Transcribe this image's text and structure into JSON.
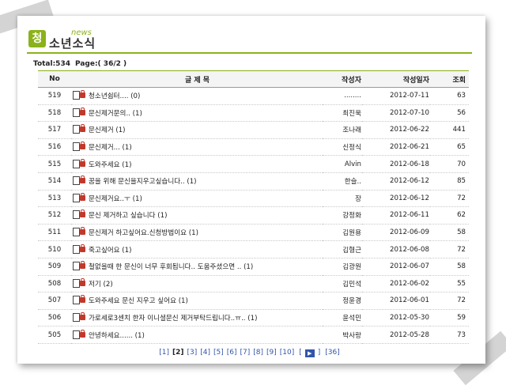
{
  "header": {
    "logo_char": "청",
    "logo_small": "news",
    "title": "소년소식"
  },
  "summary": {
    "total": "Total:534",
    "page": "Page:( 36/2 )"
  },
  "columns": {
    "no": "No",
    "title": "글 제 목",
    "author": "작성자",
    "date": "작성일자",
    "views": "조회"
  },
  "rows": [
    {
      "no": "519",
      "title": "청소년쉼터.... (0)",
      "author": "........",
      "date": "2012-07-11",
      "views": "63"
    },
    {
      "no": "518",
      "title": "문신제거문의.. (1)",
      "author": "최진욱",
      "date": "2012-07-10",
      "views": "56"
    },
    {
      "no": "517",
      "title": "문신제거 (1)",
      "author": "조나래",
      "date": "2012-06-22",
      "views": "441"
    },
    {
      "no": "516",
      "title": "문신제거... (1)",
      "author": "신정식",
      "date": "2012-06-21",
      "views": "65"
    },
    {
      "no": "515",
      "title": "도와주세요 (1)",
      "author": "Alvin",
      "date": "2012-06-18",
      "views": "70"
    },
    {
      "no": "514",
      "title": "꿈을 위해 문신을지우고싶습니다.. (1)",
      "author": "한슬..",
      "date": "2012-06-12",
      "views": "85"
    },
    {
      "no": "513",
      "title": "문신제거요..ㅜ (1)",
      "author": "장",
      "date": "2012-06-12",
      "views": "72"
    },
    {
      "no": "512",
      "title": "문신 제거하고 싶습니다 (1)",
      "author": "강정화",
      "date": "2012-06-11",
      "views": "62"
    },
    {
      "no": "511",
      "title": "문신제거 하고싶어요.신청방법이요 (1)",
      "author": "김원용",
      "date": "2012-06-09",
      "views": "58"
    },
    {
      "no": "510",
      "title": "죽고싶어요 (1)",
      "author": "김형근",
      "date": "2012-06-08",
      "views": "72"
    },
    {
      "no": "509",
      "title": "철없을때 한 문신이 너무 후회됩니다.. 도움주셨으면 .. (1)",
      "author": "김광원",
      "date": "2012-06-07",
      "views": "58"
    },
    {
      "no": "508",
      "title": "저기 (2)",
      "author": "김민석",
      "date": "2012-06-02",
      "views": "55"
    },
    {
      "no": "507",
      "title": "도와주세요 문신 지우고 싶어요 (1)",
      "author": "정윤경",
      "date": "2012-06-01",
      "views": "72"
    },
    {
      "no": "506",
      "title": "가로세로3센치 한자 이니셜문신 제거부탁드립니다..ㅠ.. (1)",
      "author": "윤석민",
      "date": "2012-05-30",
      "views": "59"
    },
    {
      "no": "505",
      "title": "안녕하세요...... (1)",
      "author": "박사랑",
      "date": "2012-05-28",
      "views": "73"
    }
  ],
  "pager": {
    "pages": [
      "[1]",
      "[2]",
      "[3]",
      "[4]",
      "[5]",
      "[6]",
      "[7]",
      "[8]",
      "[9]",
      "[10]"
    ],
    "current": "[2]",
    "next_icon": "play-next-icon",
    "next_open": "[",
    "next_close": "]",
    "last": "[36]"
  },
  "colors": {
    "accent": "#8bb21a",
    "link": "#3355aa"
  }
}
